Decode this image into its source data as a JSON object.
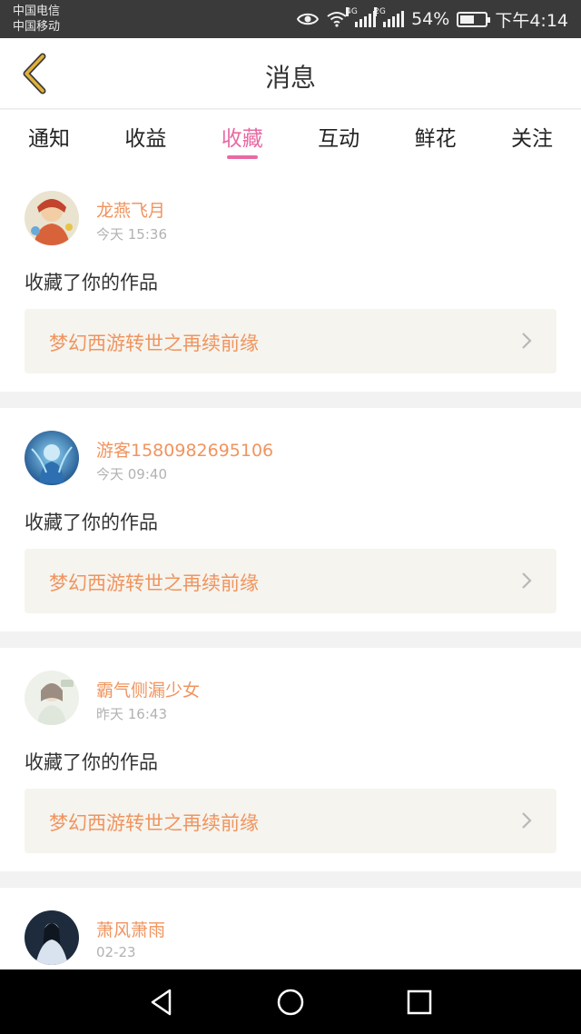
{
  "status_bar": {
    "carrier_1": "中国电信",
    "carrier_2": "中国移动",
    "network_1": "4G",
    "network_2": "2G",
    "battery": "54%",
    "time": "下午4:14",
    "icons": [
      "eye-icon",
      "wifi-icon",
      "signal-icon",
      "signal-icon",
      "battery-icon"
    ]
  },
  "header": {
    "title": "消息",
    "back_icon": "chevron-left-icon"
  },
  "tabs": [
    {
      "label": "通知",
      "active": false
    },
    {
      "label": "收益",
      "active": false
    },
    {
      "label": "收藏",
      "active": true
    },
    {
      "label": "互动",
      "active": false
    },
    {
      "label": "鲜花",
      "active": false
    },
    {
      "label": "关注",
      "active": false
    }
  ],
  "messages": [
    {
      "user": "龙燕飞月",
      "time": "今天 15:36",
      "action": "收藏了你的作品",
      "work": "梦幻西游转世之再续前缘"
    },
    {
      "user": "游客1580982695106",
      "time": "今天 09:40",
      "action": "收藏了你的作品",
      "work": "梦幻西游转世之再续前缘"
    },
    {
      "user": "霸气侧漏少女",
      "time": "昨天 16:43",
      "action": "收藏了你的作品",
      "work": "梦幻西游转世之再续前缘"
    },
    {
      "user": "萧风萧雨",
      "time": "02-23"
    }
  ],
  "colors": {
    "accent_pink": "#e86aa4",
    "accent_orange": "#f0945e",
    "back_icon_yellow": "#e0b13a"
  },
  "nav": {
    "back": "back-triangle-icon",
    "home": "home-circle-icon",
    "recents": "recents-square-icon"
  }
}
